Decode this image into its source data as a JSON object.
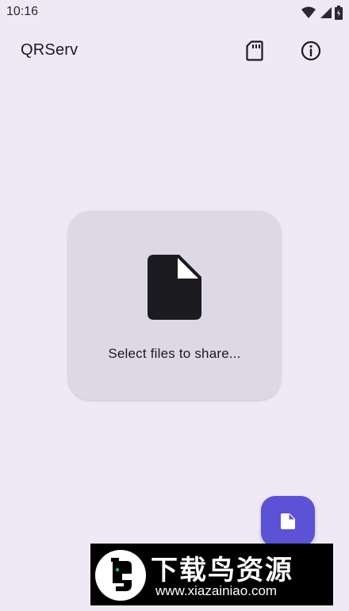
{
  "status_bar": {
    "time": "10:16",
    "icons": [
      "wifi-icon",
      "signal-icon",
      "battery-icon"
    ]
  },
  "app_bar": {
    "title": "QRServ",
    "actions": [
      "sd-card-icon",
      "info-icon"
    ]
  },
  "main": {
    "select_card": {
      "icon": "file-icon",
      "label": "Select files to share..."
    }
  },
  "fab": {
    "icon": "file-icon"
  },
  "watermark": {
    "title": "下载鸟资源",
    "url": "www.xiazainiao.com"
  },
  "colors": {
    "background": "#efe9f5",
    "card": "#ddd8e3",
    "fab": "#5b52d6",
    "text": "#1c1b1f"
  }
}
